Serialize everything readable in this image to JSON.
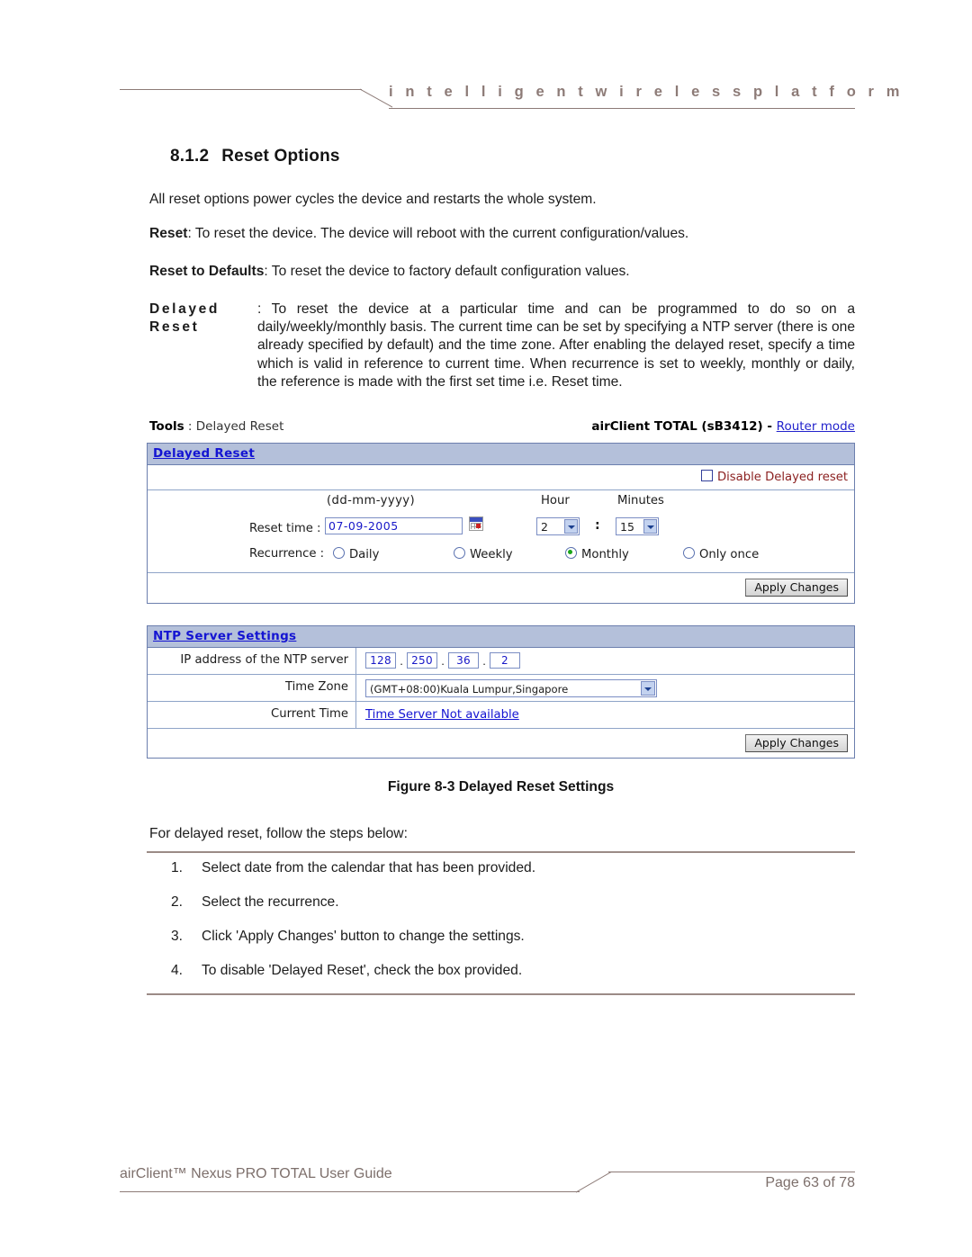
{
  "header": {
    "tagline": "i n t e l l i g e n t     w i r e l e s s     p l a t f o r m"
  },
  "section": {
    "number": "8.1.2",
    "title": "Reset Options"
  },
  "paragraphs": {
    "intro": "All reset options power cycles the device and restarts the whole system.",
    "reset_label": "Reset",
    "reset_text": ": To reset the device. The device will reboot with the current configuration/values.",
    "defaults_label": "Reset to Defaults",
    "defaults_text": ": To reset the device to factory default configuration values.",
    "delayed_label": "Delayed Reset",
    "delayed_text": ": To reset the device at a particular time and can be programmed to do so on a daily/weekly/monthly basis. The current time can be set by specifying a NTP server (there is one already specified by default) and the time zone. After enabling the delayed reset, specify a time which is valid in reference to current time. When recurrence is set to weekly, monthly or daily, the reference is made with the first set time i.e. Reset time."
  },
  "figure": {
    "topbar": {
      "tools_label": "Tools",
      "tools_sep": " : ",
      "tools_page": "Delayed Reset",
      "device": "airClient TOTAL (sB3412) - ",
      "mode_link": "Router mode"
    },
    "delayed_reset_panel": {
      "heading": "Delayed Reset",
      "disable_checkbox_label": "Disable Delayed reset",
      "disable_checked": false,
      "date_format_hint": "(dd-mm-yyyy)",
      "hour_header": "Hour",
      "minutes_header": "Minutes",
      "reset_time_label": "Reset time :",
      "reset_time_value": "07-09-2005",
      "calendar_icon": "calendar-icon",
      "hour_value": "2",
      "time_separator": ":",
      "minutes_value": "15",
      "recurrence_label": "Recurrence :",
      "recurrence_options": [
        {
          "label": "Daily",
          "selected": false
        },
        {
          "label": "Weekly",
          "selected": false
        },
        {
          "label": "Monthly",
          "selected": true
        },
        {
          "label": "Only once",
          "selected": false
        }
      ],
      "apply_button": "Apply Changes"
    },
    "ntp_panel": {
      "heading": "NTP Server Settings",
      "ip_label": "IP address of the NTP server",
      "ip_octets": [
        "128",
        "250",
        "36",
        "2"
      ],
      "ip_separator": ".",
      "timezone_label": "Time Zone",
      "timezone_value": "(GMT+08:00)Kuala Lumpur,Singapore",
      "current_time_label": "Current Time",
      "current_time_value": "Time Server Not available",
      "apply_button": "Apply Changes"
    },
    "caption": "Figure 8-3 Delayed Reset Settings"
  },
  "steps": {
    "intro": "For delayed reset, follow the steps below:",
    "items": [
      {
        "n": "1.",
        "text": "Select date from the calendar that has been provided."
      },
      {
        "n": "2.",
        "text": "Select the recurrence."
      },
      {
        "n": "3.",
        "text": "Click 'Apply Changes' button to change the settings."
      },
      {
        "n": "4.",
        "text": "To disable 'Delayed Reset', check the box provided."
      }
    ]
  },
  "footer": {
    "title": "airClient™ Nexus PRO TOTAL User Guide",
    "page": "Page 63 of 78"
  },
  "colors": {
    "accent_brown": "#8d7b77",
    "panel_header_bg": "#b4c0da",
    "panel_border": "#6c7fae",
    "link_blue": "#1414d2",
    "warning_red": "#8c2222",
    "radio_selected_green": "#1aa51a"
  }
}
